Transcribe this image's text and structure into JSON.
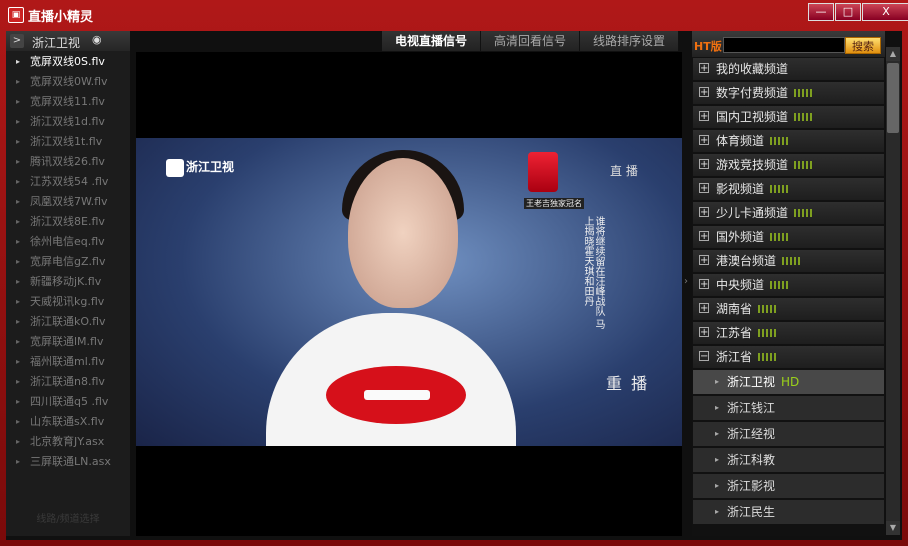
{
  "window": {
    "title": "直播小精灵",
    "minimize": "—",
    "maximize": "□",
    "close": "X"
  },
  "left": {
    "channel": "浙江卫视",
    "items": [
      {
        "label": "宽屏双线0S.flv",
        "active": true
      },
      {
        "label": "宽屏双线0W.flv"
      },
      {
        "label": "宽屏双线11.flv"
      },
      {
        "label": "浙江双线1d.flv"
      },
      {
        "label": "浙江双线1t.flv"
      },
      {
        "label": "腾讯双线26.flv"
      },
      {
        "label": "江苏双线54 .flv"
      },
      {
        "label": "凤凰双线7W.flv"
      },
      {
        "label": "浙江双线8E.flv"
      },
      {
        "label": "徐州电信eq.flv"
      },
      {
        "label": "宽屏电信gZ.flv"
      },
      {
        "label": "新疆移动jK.flv"
      },
      {
        "label": "天威视讯kg.flv"
      },
      {
        "label": "浙江联通kO.flv"
      },
      {
        "label": "宽屏联通lM.flv"
      },
      {
        "label": "福州联通ml.flv"
      },
      {
        "label": "浙江联通n8.flv"
      },
      {
        "label": "四川联通q5 .flv"
      },
      {
        "label": "山东联通sX.flv"
      },
      {
        "label": "北京教育JY.asx"
      },
      {
        "label": "三屏联通LN.asx"
      }
    ],
    "footer": "线路/频道选择"
  },
  "tabs": [
    "电视直播信号",
    "高清回看信号",
    "线路排序设置"
  ],
  "video": {
    "logo": "浙江卫视",
    "corner": "直 播",
    "vertical_text": "谁将继续留在汪峰战队 马上揭晓霍天琪和田丹",
    "can_caption": "王老吉独家冠名",
    "overlay": "重 播"
  },
  "right": {
    "ht_label": "HT版",
    "search_value": "",
    "search_button": "搜索",
    "categories": [
      {
        "label": "我的收藏频道",
        "signal": false
      },
      {
        "label": "数字付费频道",
        "signal": true
      },
      {
        "label": "国内卫视频道",
        "signal": true
      },
      {
        "label": "体育频道",
        "signal": true
      },
      {
        "label": "游戏竞技频道",
        "signal": true
      },
      {
        "label": "影视频道",
        "signal": true
      },
      {
        "label": "少儿卡通频道",
        "signal": true
      },
      {
        "label": "国外频道",
        "signal": true
      },
      {
        "label": "港澳台频道",
        "signal": true
      },
      {
        "label": "中央频道",
        "signal": true
      },
      {
        "label": "湖南省",
        "signal": true
      },
      {
        "label": "江苏省",
        "signal": true
      },
      {
        "label": "浙江省",
        "signal": true,
        "expanded": true
      }
    ],
    "subchannels": [
      {
        "label": "浙江卫视",
        "hd": "HD",
        "active": true
      },
      {
        "label": "浙江钱江"
      },
      {
        "label": "浙江经视"
      },
      {
        "label": "浙江科教"
      },
      {
        "label": "浙江影视"
      },
      {
        "label": "浙江民生"
      }
    ]
  }
}
